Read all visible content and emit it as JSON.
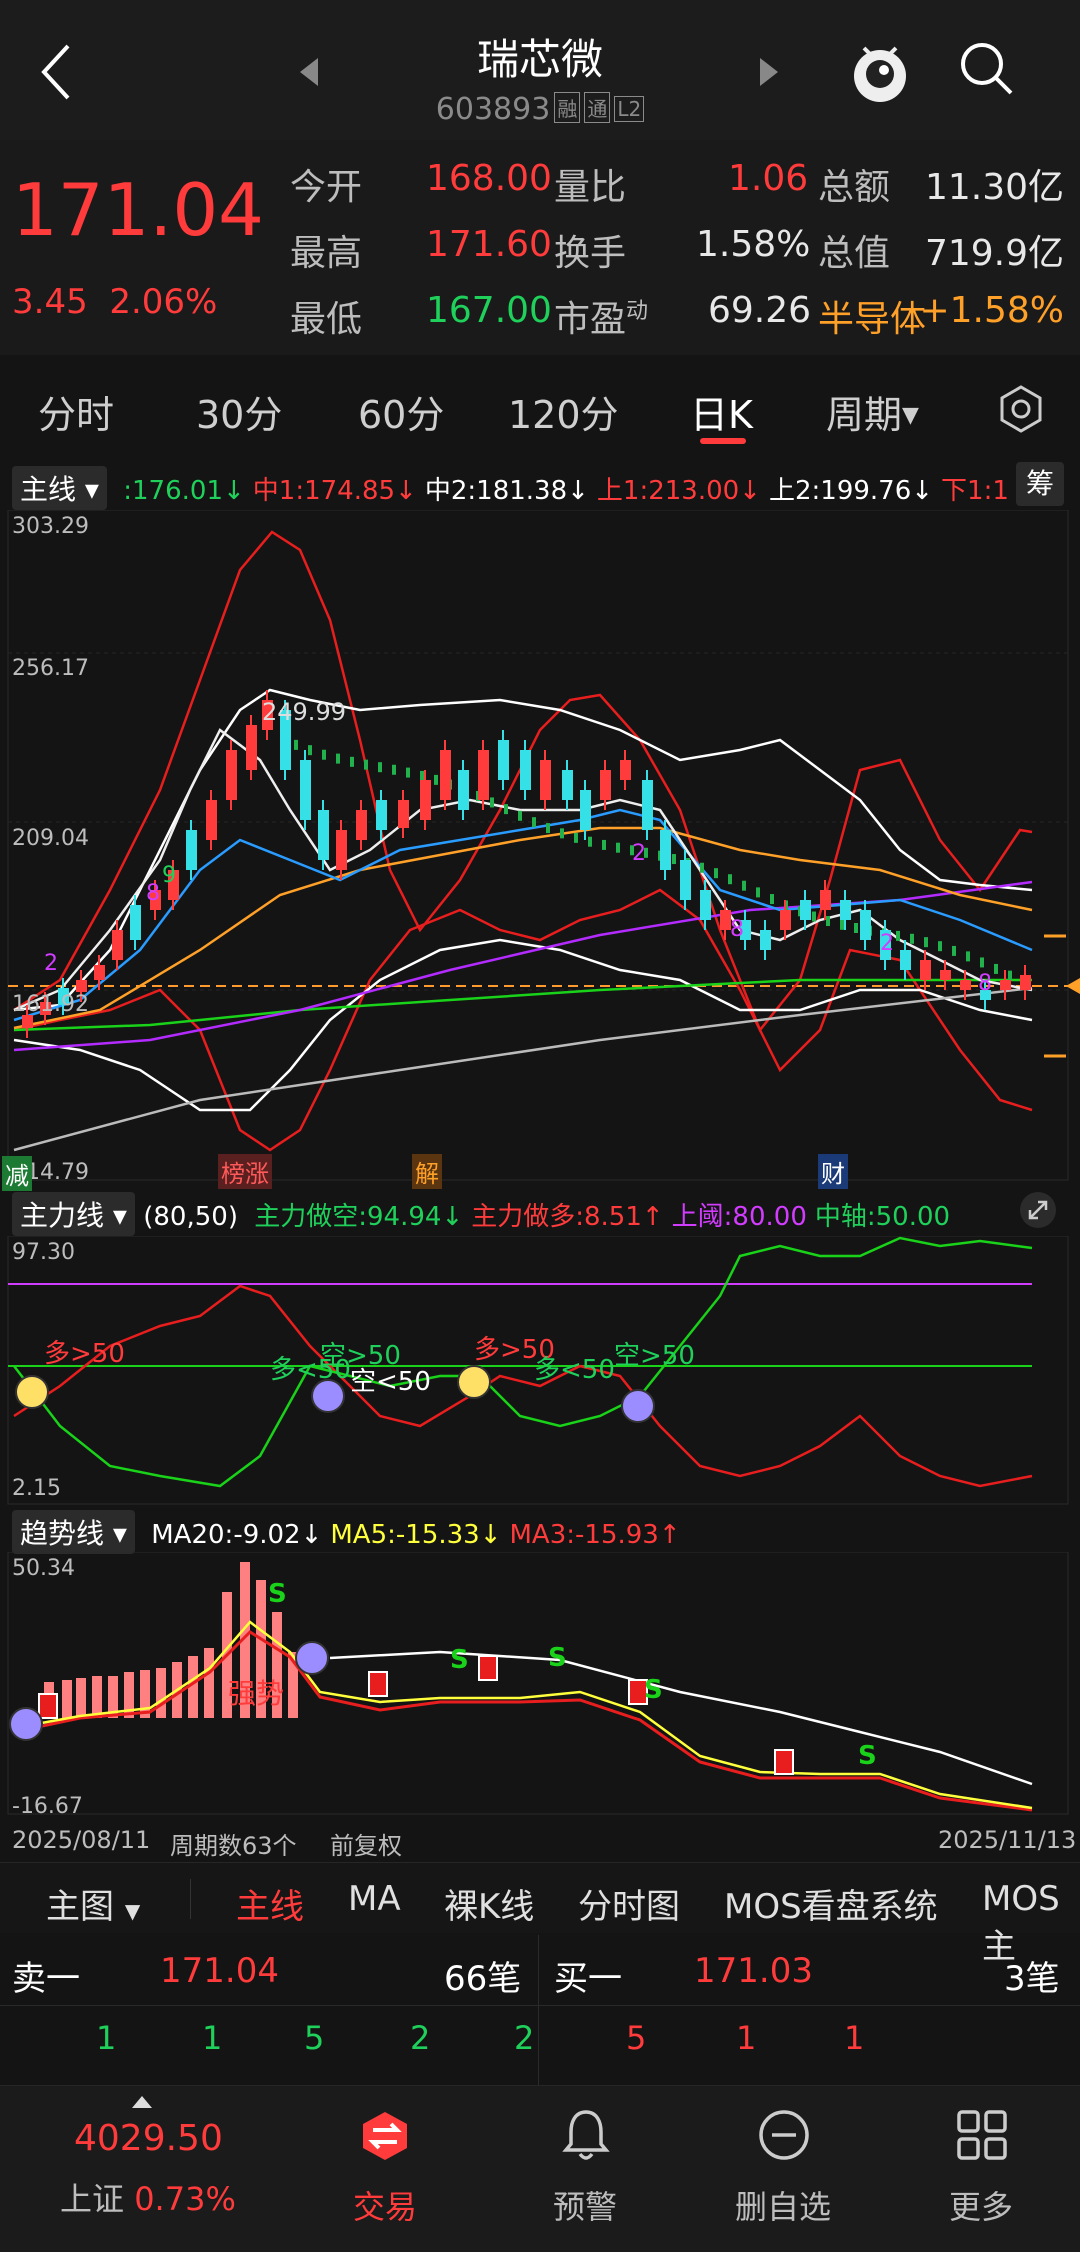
{
  "header": {
    "title": "瑞芯微",
    "code": "603893",
    "tags": [
      "融",
      "通",
      "L2"
    ]
  },
  "quote": {
    "price": "171.04",
    "change": "3.45",
    "change_pct": "2.06%",
    "rows": [
      [
        {
          "label": "今开",
          "value": "168.00",
          "color": "red"
        },
        {
          "label": "量比",
          "value": "1.06",
          "color": "red"
        },
        {
          "label": "总额",
          "value": "11.30亿",
          "color": "white"
        }
      ],
      [
        {
          "label": "最高",
          "value": "171.60",
          "color": "red"
        },
        {
          "label": "换手",
          "value": "1.58%",
          "color": "white"
        },
        {
          "label": "总值",
          "value": "719.9亿",
          "color": "white"
        }
      ],
      [
        {
          "label": "最低",
          "value": "167.00",
          "color": "green"
        },
        {
          "label": "市盈",
          "sup": "动",
          "value": "69.26",
          "color": "white"
        },
        {
          "label": "半导体",
          "value": "+1.58%",
          "color": "orange"
        }
      ]
    ]
  },
  "periods": [
    "分时",
    "30分",
    "60分",
    "120分",
    "日K",
    "周期"
  ],
  "active_period": "日K",
  "main_chart": {
    "name": "主线",
    "values": [
      {
        "text": ":176.01↓",
        "color": "#1fd15b"
      },
      {
        "text": "中1:174.85↓",
        "color": "#ff3b3b"
      },
      {
        "text": "中2:181.38↓",
        "color": "#ffffff"
      },
      {
        "text": "上1:213.00↓",
        "color": "#ff3b3b"
      },
      {
        "text": "上2:199.76↓",
        "color": "#ffffff"
      },
      {
        "text": "下1:1",
        "color": "#ff3b3b"
      }
    ],
    "side_btn": "筹",
    "y_labels": [
      "303.29",
      "256.17",
      "209.04",
      "161.92",
      "114.79"
    ],
    "peak_label": "249.99",
    "badges": [
      "减",
      "榜涨",
      "解",
      "财"
    ]
  },
  "power_chart": {
    "name": "主力线",
    "params": "(80,50)",
    "values": [
      {
        "text": "主力做空:94.94↓",
        "color": "#1fd15b"
      },
      {
        "text": "主力做多:8.51↑",
        "color": "#ff3b3b"
      },
      {
        "text": "上阈:80.00",
        "color": "#d23cff"
      },
      {
        "text": "中轴:50.00",
        "color": "#1fd15b"
      }
    ],
    "y_labels": [
      "97.30",
      "2.15"
    ],
    "annotations": [
      "多>50",
      "多<50",
      "空>50",
      "空<50",
      "多>50",
      "多<50",
      "空>50"
    ]
  },
  "trend_chart": {
    "name": "趋势线",
    "values": [
      {
        "text": "MA20:-9.02↓",
        "color": "#ffffff"
      },
      {
        "text": "MA5:-15.33↓",
        "color": "#ffff3c"
      },
      {
        "text": "MA3:-15.93↑",
        "color": "#ff3b3b"
      }
    ],
    "y_labels": [
      "50.34",
      "-16.67"
    ],
    "trend_text": "强势"
  },
  "footer": {
    "start_date": "2025/08/11",
    "period_count": "周期数63个",
    "adjust": "前复权",
    "end_date": "2025/11/13"
  },
  "bottom_tabs": [
    "主图",
    "主线",
    "MA",
    "裸K线",
    "分时图",
    "MOS看盘系统",
    "MOS主"
  ],
  "orderbook": {
    "sell_label": "卖一",
    "sell_price": "171.04",
    "sell_count": "66笔",
    "buy_label": "买一",
    "buy_price": "171.03",
    "buy_count": "3笔",
    "sell_detail": [
      "1",
      "1",
      "5",
      "2",
      "2"
    ],
    "buy_detail": [
      "5",
      "1",
      "1"
    ]
  },
  "index": {
    "value": "4029.50",
    "name": "上证",
    "pct": "0.73%"
  },
  "nav": [
    "交易",
    "预警",
    "删自选",
    "更多"
  ]
}
